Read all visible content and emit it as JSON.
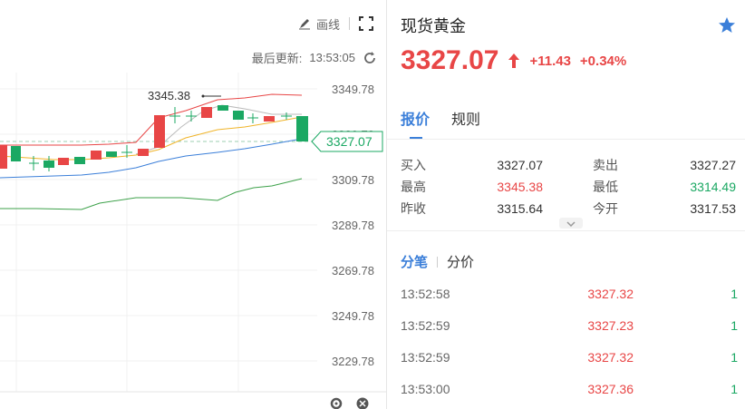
{
  "toolbar": {
    "draw_label": "画线"
  },
  "chart": {
    "last_update_label": "最后更新:",
    "last_update_time": "13:53:05",
    "y_ticks": [
      "3349.78",
      "3329.78",
      "3309.78",
      "3289.78",
      "3269.78",
      "3249.78",
      "3229.78"
    ],
    "current_price_tag": "3327.07",
    "high_annotation": "3345.38"
  },
  "instrument": {
    "title": "现货黄金",
    "price": "3327.07",
    "change": "+11.43",
    "change_pct": "+0.34%"
  },
  "tabs": [
    {
      "label": "报价",
      "active": true
    },
    {
      "label": "规则",
      "active": false
    }
  ],
  "quote": {
    "rows": [
      {
        "l1": "买入",
        "v1": "3327.07",
        "l2": "卖出",
        "v2": "3327.27"
      },
      {
        "l1": "最高",
        "v1": "3345.38",
        "l2": "最低",
        "v2": "3314.49"
      },
      {
        "l1": "昨收",
        "v1": "3315.64",
        "l2": "今开",
        "v2": "3317.53"
      }
    ]
  },
  "subtabs": [
    {
      "label": "分笔",
      "active": true
    },
    {
      "label": "分价",
      "active": false
    }
  ],
  "ticks": [
    {
      "time": "13:52:58",
      "price": "3327.32",
      "vol": "1"
    },
    {
      "time": "13:52:59",
      "price": "3327.23",
      "vol": "1"
    },
    {
      "time": "13:52:59",
      "price": "3327.32",
      "vol": "1"
    },
    {
      "time": "13:53:00",
      "price": "3327.36",
      "vol": "1"
    }
  ],
  "colors": {
    "up": "#e84646",
    "down": "#1ba863",
    "accent": "#3b7fd9"
  }
}
